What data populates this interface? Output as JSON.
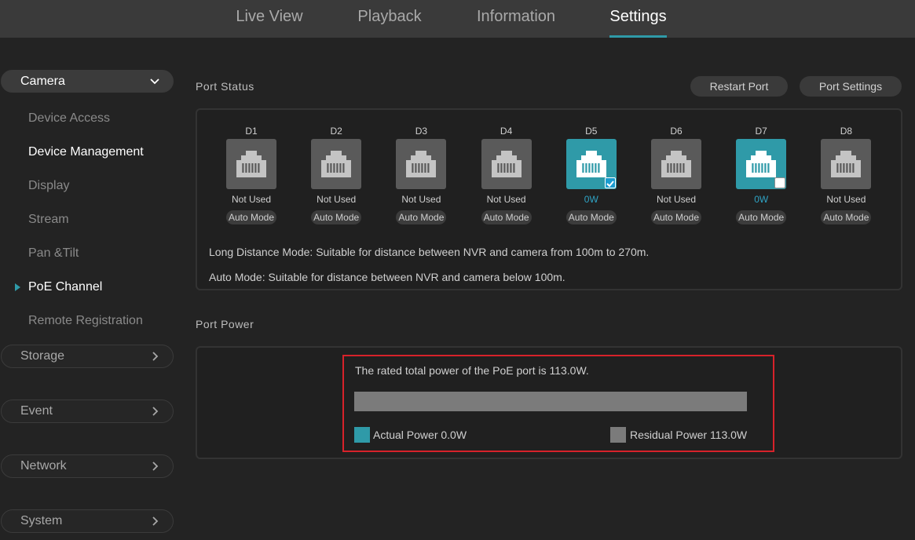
{
  "nav": {
    "tabs": [
      {
        "label": "Live View"
      },
      {
        "label": "Playback"
      },
      {
        "label": "Information"
      },
      {
        "label": "Settings",
        "active": true
      }
    ]
  },
  "sidebar": {
    "camera": {
      "label": "Camera",
      "items": [
        {
          "label": "Device Access"
        },
        {
          "label": "Device Management"
        },
        {
          "label": "Display"
        },
        {
          "label": "Stream"
        },
        {
          "label": "Pan &Tilt"
        },
        {
          "label": "PoE Channel",
          "selected": true
        },
        {
          "label": "Remote Registration"
        }
      ]
    },
    "groups": [
      {
        "label": "Storage"
      },
      {
        "label": "Event"
      },
      {
        "label": "Network"
      },
      {
        "label": "System"
      }
    ]
  },
  "port_status": {
    "title": "Port Status",
    "restart_label": "Restart Port",
    "settings_label": "Port Settings",
    "ports": [
      {
        "name": "D1",
        "status": "Not Used",
        "mode": "Auto Mode",
        "active": false,
        "checked": null
      },
      {
        "name": "D2",
        "status": "Not Used",
        "mode": "Auto Mode",
        "active": false,
        "checked": null
      },
      {
        "name": "D3",
        "status": "Not Used",
        "mode": "Auto Mode",
        "active": false,
        "checked": null
      },
      {
        "name": "D4",
        "status": "Not Used",
        "mode": "Auto Mode",
        "active": false,
        "checked": null
      },
      {
        "name": "D5",
        "status": "0W",
        "mode": "Auto Mode",
        "active": true,
        "checked": true
      },
      {
        "name": "D6",
        "status": "Not Used",
        "mode": "Auto Mode",
        "active": false,
        "checked": null
      },
      {
        "name": "D7",
        "status": "0W",
        "mode": "Auto Mode",
        "active": true,
        "checked": false
      },
      {
        "name": "D8",
        "status": "Not Used",
        "mode": "Auto Mode",
        "active": false,
        "checked": null
      }
    ],
    "note_long": "Long Distance Mode: Suitable for distance between NVR and camera from 100m to 270m.",
    "note_auto": "Auto Mode: Suitable for distance between NVR and camera below 100m."
  },
  "port_power": {
    "title": "Port Power",
    "rated_text": "The rated total power of the PoE port is 113.0W.",
    "actual_fraction": 0.0,
    "actual_label": "Actual Power 0.0W",
    "residual_label": "Residual Power 113.0W"
  },
  "colors": {
    "accent": "#2f9aa8",
    "highlight_border": "#d7222a",
    "residual": "#7b7b7b"
  }
}
